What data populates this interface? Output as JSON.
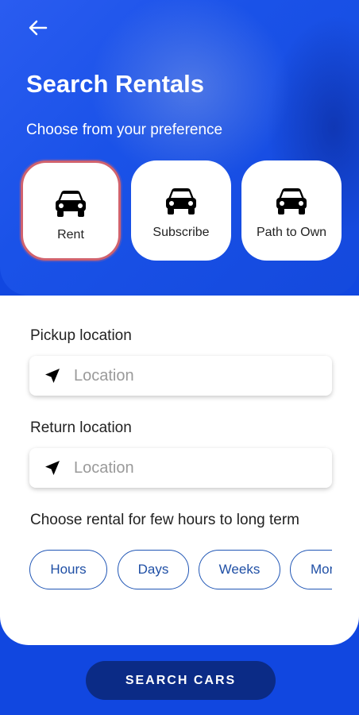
{
  "header": {
    "title": "Search Rentals",
    "subtitle": "Choose from your preference"
  },
  "options": [
    {
      "label": "Rent",
      "selected": true,
      "icon": "car-icon"
    },
    {
      "label": "Subscribe",
      "selected": false,
      "icon": "car-icon"
    },
    {
      "label": "Path to Own",
      "selected": false,
      "icon": "car-icon"
    }
  ],
  "pickup": {
    "label": "Pickup location",
    "placeholder": "Location",
    "icon": "navigation-arrow-icon"
  },
  "return": {
    "label": "Return location",
    "placeholder": "Location",
    "icon": "navigation-arrow-icon"
  },
  "duration": {
    "label": "Choose rental for few hours to long term",
    "options": [
      "Hours",
      "Days",
      "Weeks",
      "Months"
    ]
  },
  "search_button": "SEARCH CARS",
  "colors": {
    "primary": "#1147e0",
    "button": "#0b2b86",
    "selected_border": "#d0626e",
    "pill_border": "#2056b5"
  }
}
